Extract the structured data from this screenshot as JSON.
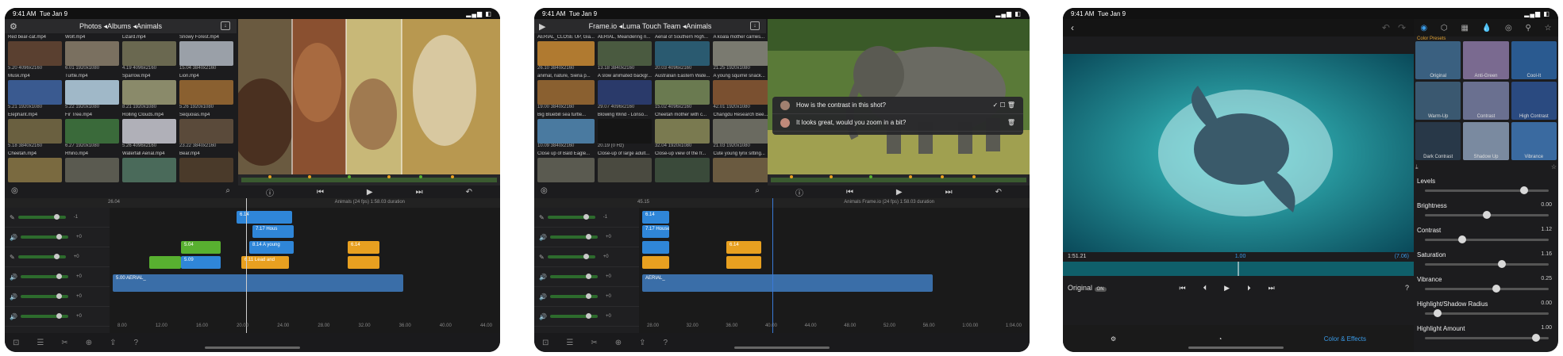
{
  "status": {
    "time": "9:41 AM",
    "date": "Tue Jan 9"
  },
  "panel1": {
    "breadcrumb": "Photos ◂Albums ◂Animals",
    "clips": [
      {
        "name": "Red bear-cat.mp4",
        "meta": "5.20  4096x2160",
        "color": "#5a4030"
      },
      {
        "name": "Wolf.mp4",
        "meta": "6.01  1920x1080",
        "color": "#7a7060"
      },
      {
        "name": "Lizard.mp4",
        "meta": "4.19  4096x2160",
        "color": "#6a6850"
      },
      {
        "name": "Snowy Forest.mp4",
        "meta": "15.04  3840x2160",
        "color": "#9aa0a8"
      },
      {
        "name": "Musk.mp4",
        "meta": "5.21  1920x1080",
        "color": "#3a5a90"
      },
      {
        "name": "Turtle.mp4",
        "meta": "5.22  1920x1080",
        "color": "#a0b8c8"
      },
      {
        "name": "Sparrow.mp4",
        "meta": "8.21  1920x1080",
        "color": "#8a8a6a"
      },
      {
        "name": "Lion.mp4",
        "meta": "5.26  1920x1080",
        "color": "#8a6030"
      },
      {
        "name": "Elephant.mp4",
        "meta": "5.18  3840x2160",
        "color": "#6a6040"
      },
      {
        "name": "Fir Tree.mp4",
        "meta": "6.27  1920x1080",
        "color": "#3a6a3a"
      },
      {
        "name": "Rolling Clouds.mp4",
        "meta": "5.26  4096x2160",
        "color": "#b0b0b8"
      },
      {
        "name": "Sequoias.mp4",
        "meta": "23.22  3840x2160",
        "color": "#5a4a3a"
      },
      {
        "name": "Cheetah.mp4",
        "meta": "",
        "color": "#7a6a40"
      },
      {
        "name": "Rhino.mp4",
        "meta": "",
        "color": "#5a5a50"
      },
      {
        "name": "Waterfall Aerial.mp4",
        "meta": "",
        "color": "#4a6a5a"
      },
      {
        "name": "Bear.mp4",
        "meta": "",
        "color": "#4a3a2a"
      }
    ],
    "timecode": "26.04",
    "project": "Animals (24 fps) 1:58.03 duration",
    "ruler": [
      "8.00",
      "12.00",
      "16.00",
      "20.00",
      "24.00",
      "28.00",
      "32.00",
      "36.00",
      "40.00",
      "44.00"
    ],
    "track_values": [
      "-1",
      "+0",
      "+0",
      "+0",
      "+0"
    ]
  },
  "panel2": {
    "breadcrumb": "Frame.io ◂Luma Touch Team ◂Animals",
    "clips": [
      {
        "name": "AERIAL_CLOSE UP, Gia...",
        "meta": "26.10  3840x2160",
        "color": "#b07a30"
      },
      {
        "name": "AERIAL, Meandering ri...",
        "meta": "13.18  3840x2160",
        "color": "#4a5a40"
      },
      {
        "name": "Aerial of Southern Righ...",
        "meta": "20.03  4096x2160",
        "color": "#2a5a70"
      },
      {
        "name": "A koala mother carries...",
        "meta": "21.25  1920x1080",
        "color": "#7a7a70"
      },
      {
        "name": "animal, nature, Siena p...",
        "meta": "19.00  3840x2160",
        "color": "#8a6030"
      },
      {
        "name": "A slow animated backgr...",
        "meta": "29.07  4096x2160",
        "color": "#2a3a6a"
      },
      {
        "name": "Australian Eastern Wate...",
        "meta": "15.02  4096x2160",
        "color": "#6a7a50"
      },
      {
        "name": "A young squirrel snack...",
        "meta": "42.01  1920x1080",
        "color": "#7a5030"
      },
      {
        "name": "Big Bluebill sea turtle...",
        "meta": "10.09  3840x2160",
        "color": "#4a7aa0"
      },
      {
        "name": "Blowing Wind - Lonso...",
        "meta": "20.19  (0 Hz)",
        "color": "#151515"
      },
      {
        "name": "Cheetah mother with c...",
        "meta": "32.04  1920x1080",
        "color": "#7a7a50"
      },
      {
        "name": "Changdu Research Bee...",
        "meta": "21.03  1920x1080",
        "color": "#6a6a60"
      },
      {
        "name": "Close up of Bald Eagle...",
        "meta": "",
        "color": "#5a5a50"
      },
      {
        "name": "Close-up of large adult...",
        "meta": "",
        "color": "#4a4a40"
      },
      {
        "name": "Close-up view of the fr...",
        "meta": "",
        "color": "#3a4a3a"
      },
      {
        "name": "Cute young lynx sitting...",
        "meta": "",
        "color": "#6a5a40"
      }
    ],
    "comments": [
      {
        "text": "How is the contrast in this shot?"
      },
      {
        "text": "It looks great, would you zoom in a bit?"
      }
    ],
    "timecode": "45.15",
    "project": "Animals Frame.io (24 fps) 1:58.03 duration",
    "ruler": [
      "28.00",
      "32.00",
      "36.00",
      "40.00",
      "44.00",
      "48.00",
      "52.00",
      "56.00",
      "1:00.00",
      "1:04.00"
    ]
  },
  "panel3": {
    "timecode_left": "1:51.21",
    "timecode_mid": "1.00",
    "timecode_right": "(7.06)",
    "original_label": "Original",
    "original_badge": "ON",
    "bottom_tab": "Color & Effects",
    "presets_label": "Color Presets",
    "presets": [
      {
        "name": "Original",
        "color": "#3a6080"
      },
      {
        "name": "Anti-Green",
        "color": "#7a6a90"
      },
      {
        "name": "Cool-It",
        "color": "#2a5a90"
      },
      {
        "name": "Warm-Up",
        "color": "#3a5870"
      },
      {
        "name": "Contrast",
        "color": "#6a7090"
      },
      {
        "name": "High Contrast",
        "color": "#2a4a80"
      },
      {
        "name": "Dark Contrast",
        "color": "#283848"
      },
      {
        "name": "Shadow Up",
        "color": "#7a8aa0"
      },
      {
        "name": "Vibrance",
        "color": "#3a6aa0"
      }
    ],
    "sliders": [
      {
        "label": "Levels",
        "value": "",
        "pos": 0.8
      },
      {
        "label": "Brightness",
        "value": "0.00",
        "pos": 0.5
      },
      {
        "label": "Contrast",
        "value": "1.12",
        "pos": 0.3
      },
      {
        "label": "Saturation",
        "value": "1.16",
        "pos": 0.62
      },
      {
        "label": "Vibrance",
        "value": "0.25",
        "pos": 0.58
      },
      {
        "label": "Highlight/Shadow Radius",
        "value": "0.00",
        "pos": 0.1
      },
      {
        "label": "Highlight Amount",
        "value": "1.00",
        "pos": 0.9
      }
    ]
  }
}
